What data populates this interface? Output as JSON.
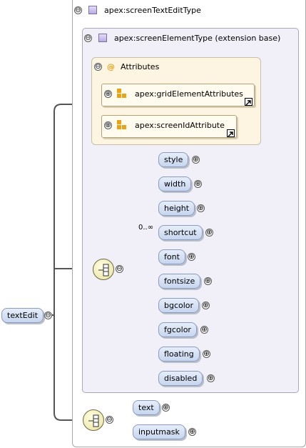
{
  "outer": {
    "type_label": "apex:screenTextEditType",
    "toggle": "⊖"
  },
  "extension": {
    "label": "apex:screenElementType (extension base)",
    "toggle": "⊖"
  },
  "attributes": {
    "title": "Attributes",
    "at_symbol": "@",
    "toggle": "⊖",
    "items": [
      {
        "label": "apex:gridElementAttributes",
        "toggle": "⊕"
      },
      {
        "label": "apex:screenIdAttribute",
        "toggle": "⊕"
      }
    ]
  },
  "root": {
    "label": "textEdit",
    "toggle": "⊖"
  },
  "sequence1": {
    "toggle": "⊖",
    "elements": [
      {
        "label": "style",
        "toggle": "⊕",
        "occurrence": ""
      },
      {
        "label": "width",
        "toggle": "⊕",
        "occurrence": ""
      },
      {
        "label": "height",
        "toggle": "⊕",
        "occurrence": ""
      },
      {
        "label": "shortcut",
        "toggle": "⊕",
        "occurrence": "0..∞"
      },
      {
        "label": "font",
        "toggle": "⊕",
        "occurrence": ""
      },
      {
        "label": "fontsize",
        "toggle": "⊕",
        "occurrence": ""
      },
      {
        "label": "bgcolor",
        "toggle": "⊕",
        "occurrence": ""
      },
      {
        "label": "fgcolor",
        "toggle": "⊕",
        "occurrence": ""
      },
      {
        "label": "floating",
        "toggle": "⊕",
        "occurrence": ""
      },
      {
        "label": "disabled",
        "toggle": "⊕",
        "occurrence": ""
      }
    ]
  },
  "sequence2": {
    "toggle": "⊖",
    "elements": [
      {
        "label": "text",
        "toggle": "⊕"
      },
      {
        "label": "inputmask",
        "toggle": "⊕"
      }
    ]
  },
  "colors": {
    "outer_border": "#a8a8a8",
    "extension_fill": "#f1eff8",
    "attributes_fill": "#fdf4e1",
    "element_fill": "#d6e1f5",
    "connector": "#555555",
    "attribute_icon": "#e8a317"
  }
}
